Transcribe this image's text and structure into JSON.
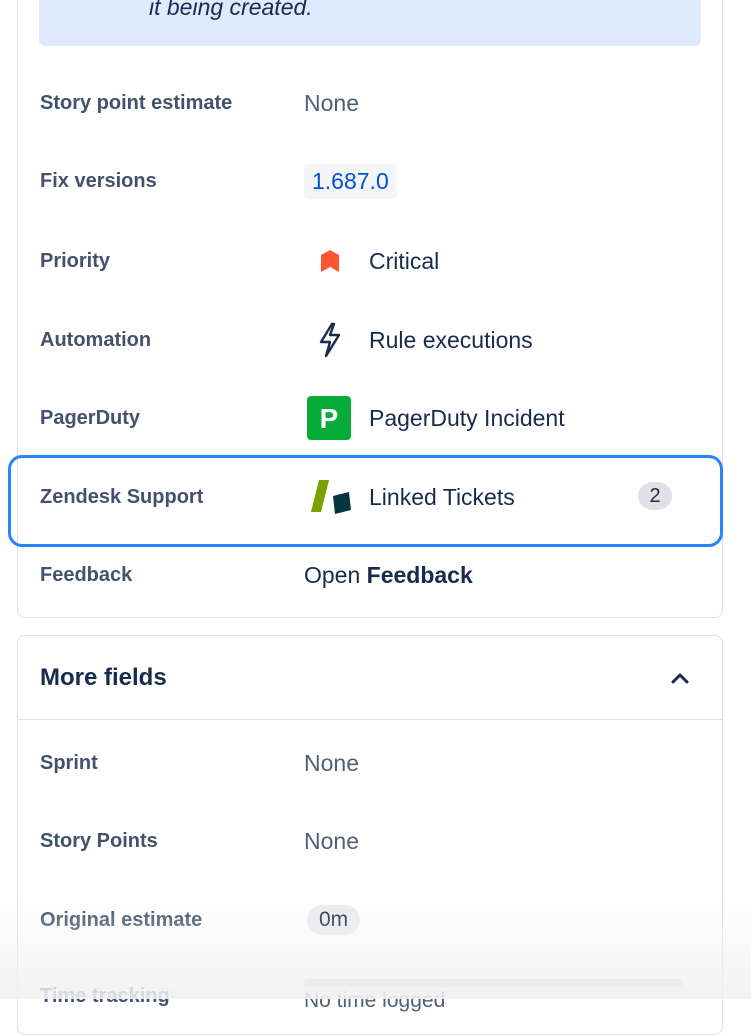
{
  "info_banner": {
    "text": "it being created."
  },
  "fields": {
    "story_point_estimate": {
      "label": "Story point estimate",
      "value": "None"
    },
    "fix_versions": {
      "label": "Fix versions",
      "value": "1.687.0"
    },
    "priority": {
      "label": "Priority",
      "value": "Critical",
      "icon": "priority-critical-icon",
      "color": "#ff5630"
    },
    "automation": {
      "label": "Automation",
      "value": "Rule executions",
      "icon": "lightning-bolt-icon"
    },
    "pagerduty": {
      "label": "PagerDuty",
      "value": "PagerDuty Incident",
      "icon": "pagerduty-icon",
      "icon_letter": "P",
      "color": "#06ac38"
    },
    "zendesk": {
      "label": "Zendesk Support",
      "value": "Linked Tickets",
      "count": "2",
      "icon": "zendesk-icon"
    },
    "feedback": {
      "label": "Feedback",
      "value_prefix": "Open",
      "value_bold": "Feedback"
    }
  },
  "more_fields": {
    "title": "More fields",
    "expanded": true,
    "sprint": {
      "label": "Sprint",
      "value": "None"
    },
    "story_points": {
      "label": "Story Points",
      "value": "None"
    },
    "original_estimate": {
      "label": "Original estimate",
      "value": "0m"
    },
    "time_tracking": {
      "label": "Time tracking",
      "value": "No time logged"
    }
  },
  "colors": {
    "accent": "#2684ff",
    "link": "#0052cc"
  }
}
